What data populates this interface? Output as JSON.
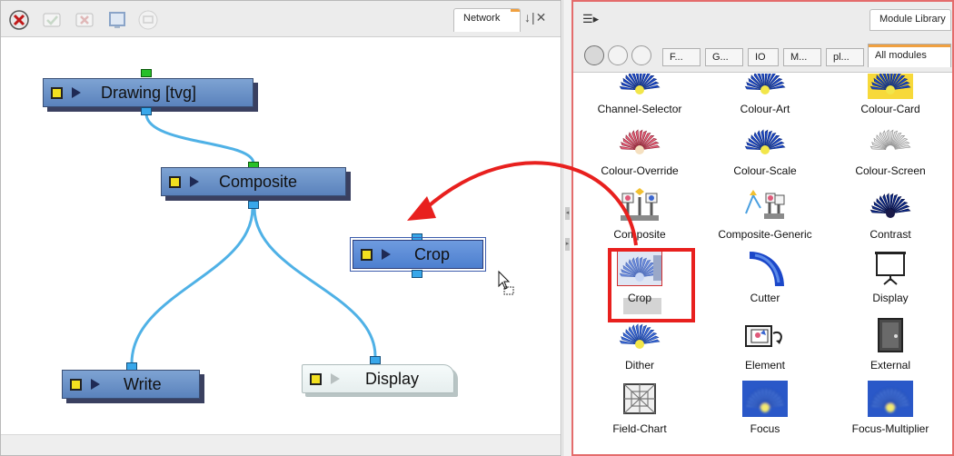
{
  "network": {
    "tab_label": "Network",
    "tab_controls": "↓|✕",
    "toolbar": [
      "delete-icon",
      "enable-icon",
      "disable-icon",
      "screen-icon",
      "monitor-icon"
    ],
    "nodes": {
      "drawing": "Drawing  [tvg]",
      "composite": "Composite",
      "crop": "Crop",
      "write": "Write",
      "display": "Display"
    }
  },
  "library": {
    "tab_label": "Module Library",
    "category_tabs": [
      "F...",
      "G...",
      "IO",
      "M...",
      "pl...",
      "All modules"
    ],
    "active_tab": "All modules",
    "modules": [
      {
        "name": "Channel-Selector",
        "icon": "flower-blue-icon"
      },
      {
        "name": "Colour-Art",
        "icon": "flower-blue-icon"
      },
      {
        "name": "Colour-Card",
        "icon": "flower-yellow-card-icon"
      },
      {
        "name": "Colour-Override",
        "icon": "flower-red-icon"
      },
      {
        "name": "Colour-Scale",
        "icon": "flower-blue-icon"
      },
      {
        "name": "Colour-Screen",
        "icon": "flower-outline-icon"
      },
      {
        "name": "Composite",
        "icon": "composite-icon"
      },
      {
        "name": "Composite-Generic",
        "icon": "composite-generic-icon"
      },
      {
        "name": "Contrast",
        "icon": "flower-dark-icon"
      },
      {
        "name": "Crop",
        "icon": "crop-icon"
      },
      {
        "name": "Cutter",
        "icon": "cutter-icon"
      },
      {
        "name": "Display",
        "icon": "display-icon"
      },
      {
        "name": "Dither",
        "icon": "flower-dither-icon"
      },
      {
        "name": "Element",
        "icon": "element-icon"
      },
      {
        "name": "External",
        "icon": "external-icon"
      },
      {
        "name": "Field-Chart",
        "icon": "field-chart-icon"
      },
      {
        "name": "Focus",
        "icon": "flower-blur-icon"
      },
      {
        "name": "Focus-Multiplier",
        "icon": "flower-blur-icon"
      }
    ]
  },
  "colors": {
    "node_blue": "#6a92cc",
    "port_green": "#28c028",
    "port_blue": "#38a7ea",
    "highlight_red": "#e8201e",
    "cable": "#4fb1e6"
  }
}
